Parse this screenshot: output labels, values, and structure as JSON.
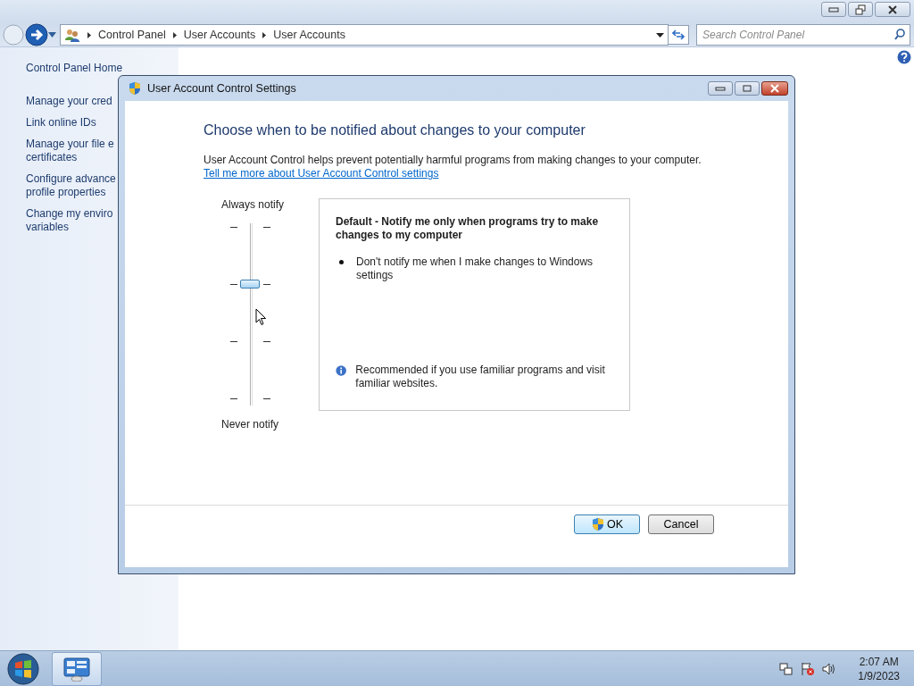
{
  "explorer": {
    "breadcrumb": [
      "Control Panel",
      "User Accounts",
      "User Accounts"
    ],
    "search": {
      "placeholder": "Search Control Panel"
    },
    "sidebar": {
      "items": [
        {
          "lines": [
            "Control Panel Home"
          ]
        },
        {
          "lines": [
            "Manage your cred"
          ]
        },
        {
          "lines": [
            "Link online IDs"
          ]
        },
        {
          "lines": [
            "Manage your file e",
            "certificates"
          ]
        },
        {
          "lines": [
            "Configure advance",
            "profile properties"
          ]
        },
        {
          "lines": [
            "Change my enviro",
            "variables"
          ]
        }
      ]
    }
  },
  "dialog": {
    "title": "User Account Control Settings",
    "heading": "Choose when to be notified about changes to your computer",
    "description": "User Account Control helps prevent potentially harmful programs from making changes to your computer.",
    "link": "Tell me more about User Account Control settings",
    "slider": {
      "top_label": "Always notify",
      "bottom_label": "Never notify",
      "level": 0.667
    },
    "info": {
      "title": "Default - Notify me only when programs try to make changes to my computer",
      "bullets": [
        "Don't notify me when I make changes to Windows settings"
      ],
      "recommendation": "Recommended if you use familiar programs and visit familiar websites."
    },
    "buttons": [
      {
        "label": "OK",
        "default": true
      },
      {
        "label": "Cancel",
        "default": false
      }
    ]
  },
  "taskbar": {
    "time": "2:07 AM",
    "date": "1/9/2023"
  }
}
